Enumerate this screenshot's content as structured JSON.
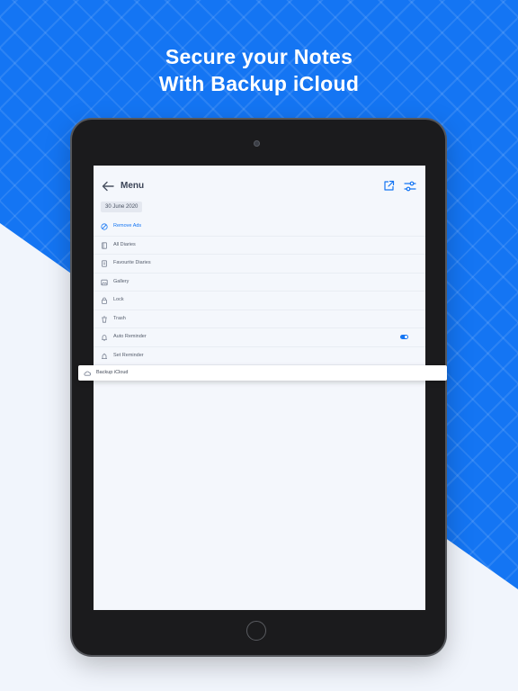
{
  "headline": {
    "line1": "Secure your Notes",
    "line2": "With Backup iCloud"
  },
  "colors": {
    "brand_blue": "#1475f3",
    "background_light": "#f1f5fc",
    "device_frame": "#1b1b1d"
  },
  "menu": {
    "title": "Menu",
    "date": "30 June 2020",
    "items": [
      {
        "label": "Remove Ads",
        "icon": "no-ads-icon",
        "active": true
      },
      {
        "label": "All Diaries",
        "icon": "book-icon"
      },
      {
        "label": "Favourite Diaries",
        "icon": "bookmark-icon"
      },
      {
        "label": "Gallery",
        "icon": "image-icon"
      },
      {
        "label": "Lock",
        "icon": "lock-icon"
      },
      {
        "label": "Trash",
        "icon": "trash-icon"
      },
      {
        "label": "Auto Reminder",
        "icon": "bell-icon",
        "toggle_on": true
      },
      {
        "label": "Set Reminder",
        "icon": "alarm-icon"
      }
    ],
    "highlighted_item": {
      "label": "Backup iCloud",
      "icon": "cloud-icon"
    }
  }
}
